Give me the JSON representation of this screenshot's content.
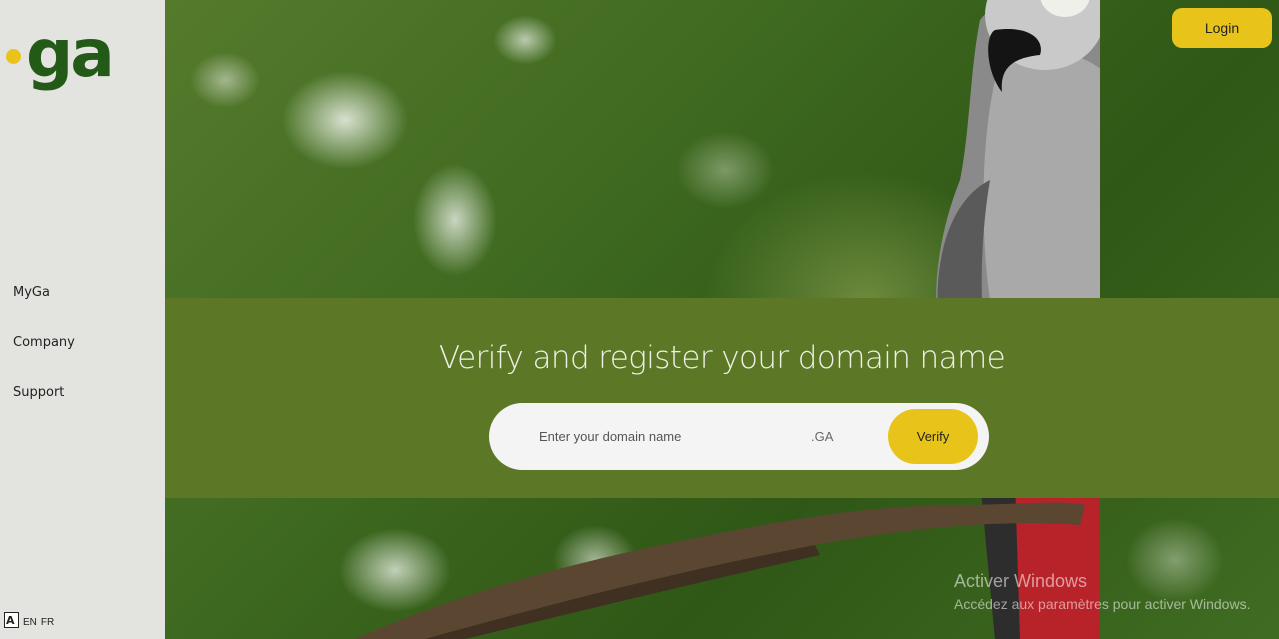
{
  "brand": {
    "logo_text": "ga",
    "dot_color": "#e9c31b",
    "text_color": "#235a17"
  },
  "nav": {
    "items": [
      {
        "label": "MyGa"
      },
      {
        "label": "Company"
      },
      {
        "label": "Support"
      }
    ]
  },
  "language": {
    "icon": "translate-icon",
    "options": [
      "EN",
      "FR"
    ]
  },
  "header": {
    "login_label": "Login"
  },
  "hero": {
    "title": "Verify and register your domain name",
    "search": {
      "placeholder": "Enter your domain name",
      "value": "",
      "tld": ".GA",
      "button_label": "Verify"
    },
    "band_color": "#5c7826",
    "accent_color": "#e8c41b"
  },
  "os_watermark": {
    "title": "Activer Windows",
    "subtitle": "Accédez aux paramètres pour activer Windows."
  }
}
